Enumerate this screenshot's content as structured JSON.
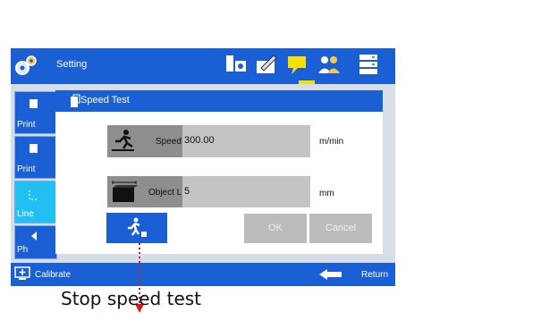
{
  "header": {
    "title": "Setting"
  },
  "sidebar": {
    "items": [
      {
        "label": "Print",
        "icon": "print-icon"
      },
      {
        "label": "Print",
        "icon": "print-icon"
      },
      {
        "label": "Line",
        "icon": "line-icon"
      },
      {
        "label": "Ph",
        "icon": "photo-icon"
      }
    ]
  },
  "dialog": {
    "title": "Speed Test",
    "speed_label": "Speed",
    "speed_value": "300.00",
    "speed_unit": "m/min",
    "object_label": "Object L",
    "object_value": "5",
    "object_unit": "mm",
    "ok_label": "OK",
    "cancel_label": "Cancel"
  },
  "footer": {
    "calibrate_label": "Calibrate",
    "return_label": "Return"
  },
  "annotation": {
    "text": "Stop speed test"
  },
  "colors": {
    "accent": "#1a5fd4",
    "active": "#22c0f0",
    "highlight": "#f6e000",
    "arrow": "#d41c1c"
  }
}
